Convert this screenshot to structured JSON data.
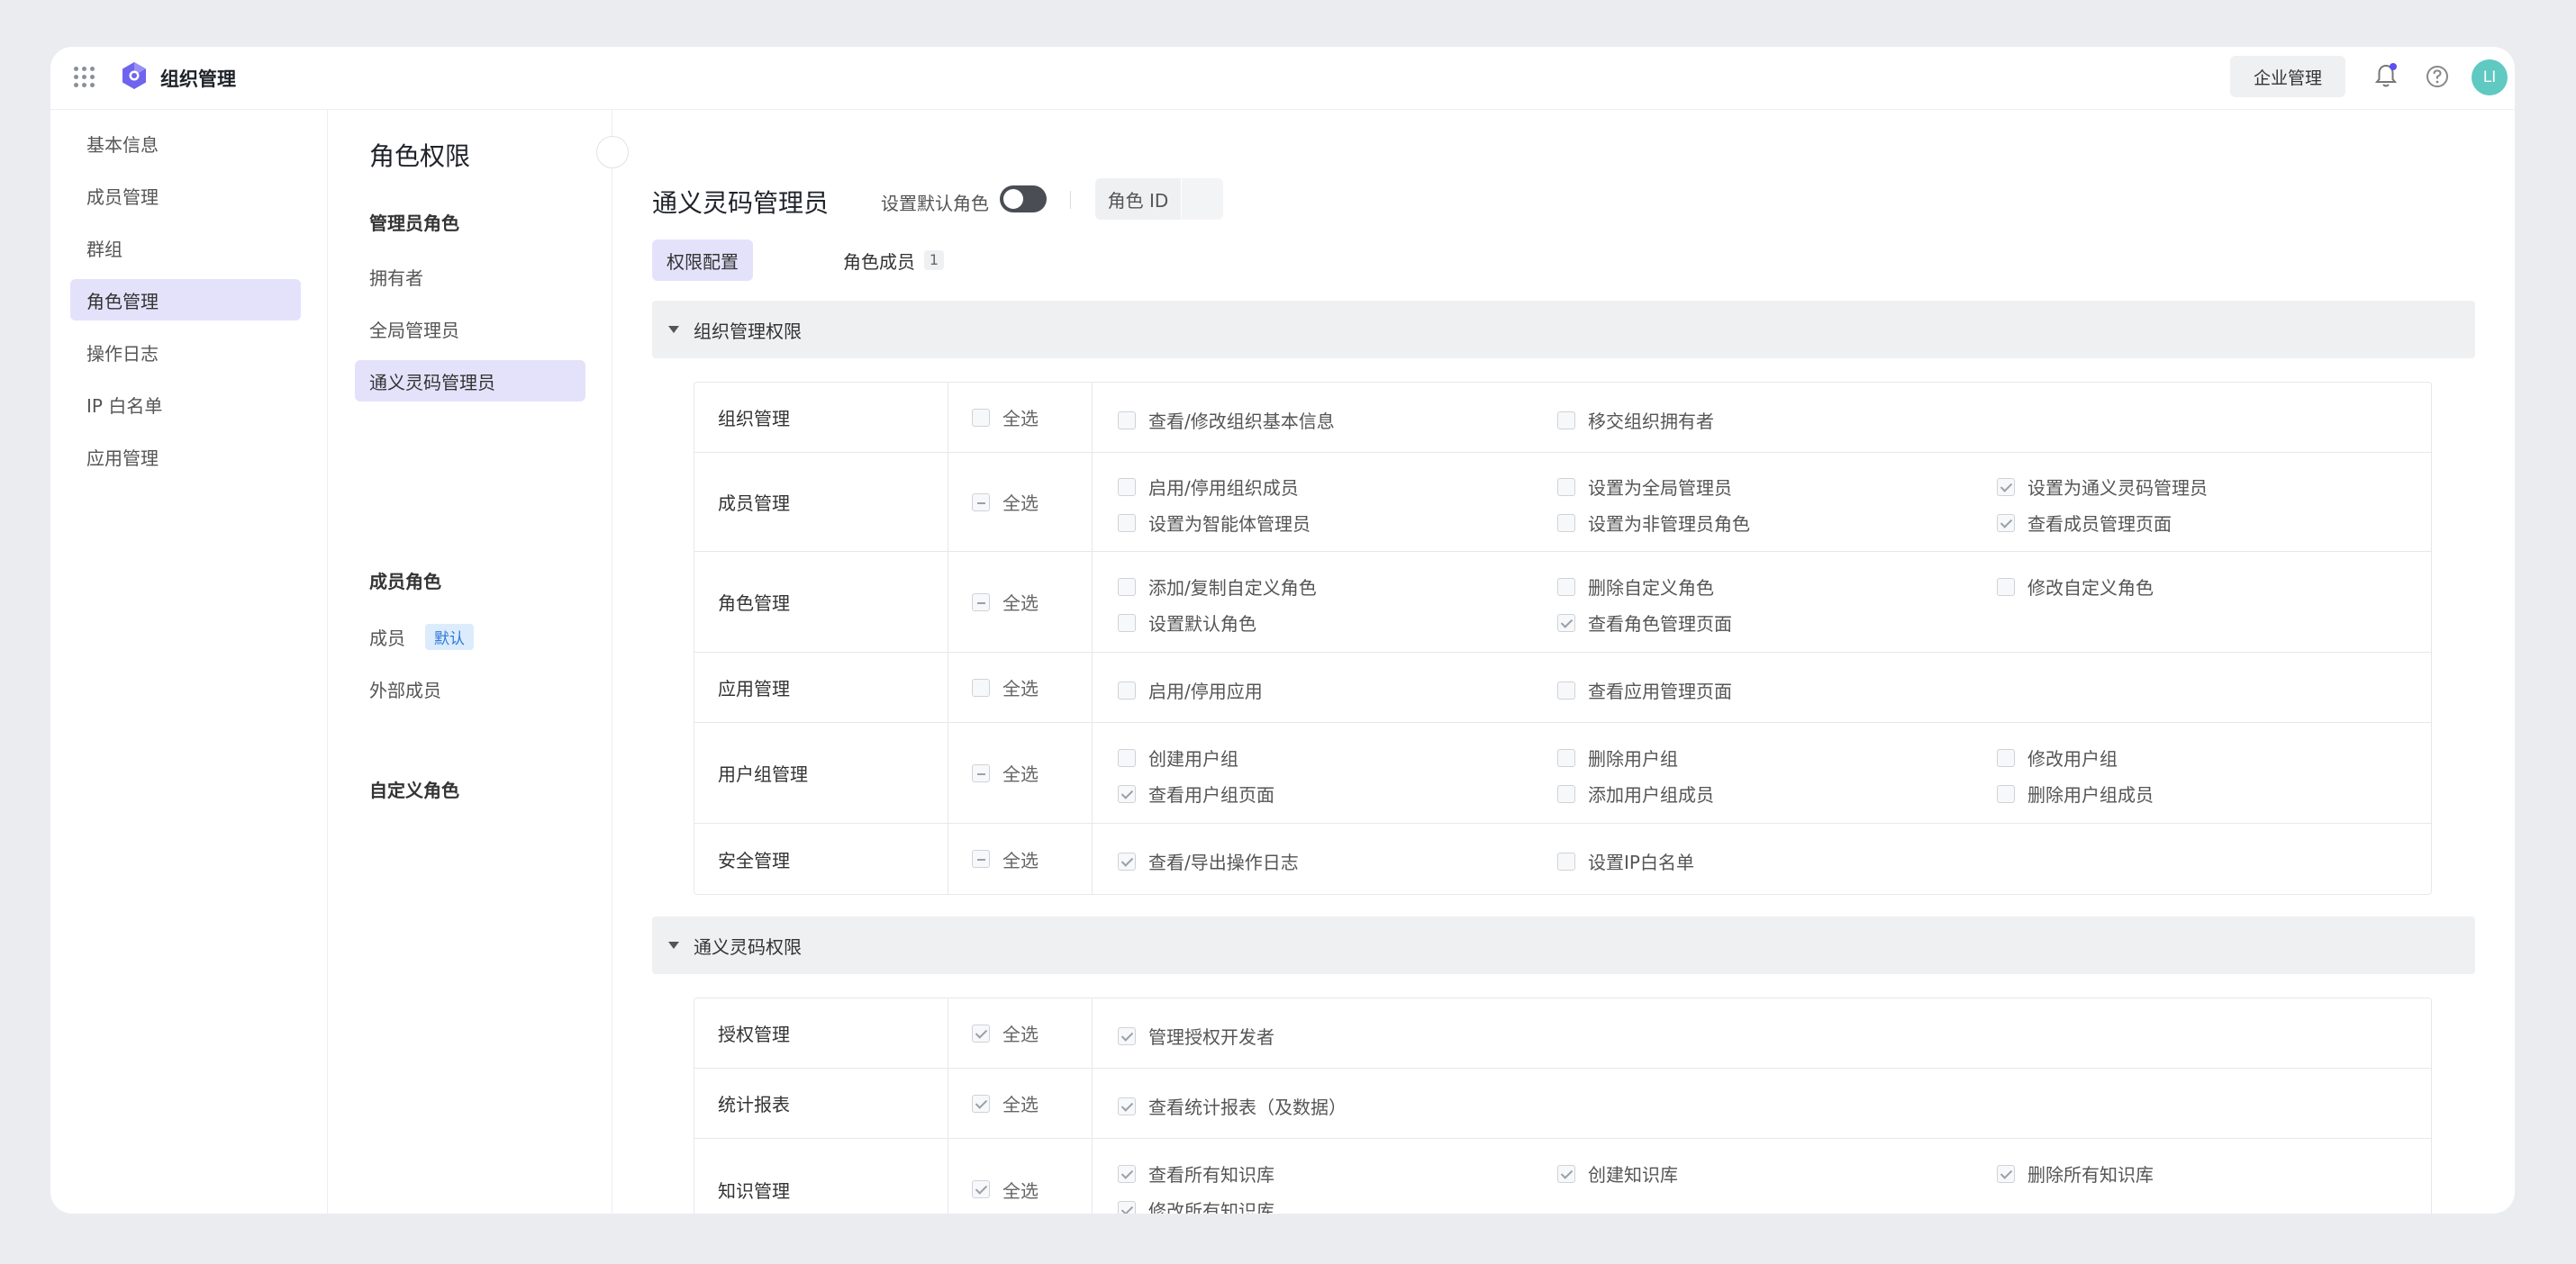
{
  "app": {
    "title": "组织管理"
  },
  "topbar": {
    "enterprise_label": "企业管理",
    "avatar_text": "LI"
  },
  "leftnav": {
    "items": [
      "基本信息",
      "成员管理",
      "群组",
      "角色管理",
      "操作日志",
      "IP 白名单",
      "应用管理"
    ],
    "active_index": 3
  },
  "rolepanel": {
    "title": "角色权限",
    "admin_section": "管理员角色",
    "admin_roles": [
      "拥有者",
      "全局管理员",
      "通义灵码管理员"
    ],
    "member_section": "成员角色",
    "member_roles": [
      "成员",
      "外部成员"
    ],
    "default_badge": "默认",
    "custom_section": "自定义角色"
  },
  "main": {
    "role_name": "通义灵码管理员",
    "set_default_label": "设置默认角色",
    "role_id_label": "角色 ID",
    "tabs": [
      {
        "label": "权限配置"
      },
      {
        "label": "角色成员",
        "count": "1"
      }
    ],
    "select_all_label": "全选",
    "groups": [
      {
        "title": "组织管理权限",
        "rows": [
          {
            "category": "组织管理",
            "state": "none",
            "options": [
              {
                "label": "查看/修改组织基本信息",
                "checked": false
              },
              {
                "label": "移交组织拥有者",
                "checked": false
              }
            ]
          },
          {
            "category": "成员管理",
            "state": "partial",
            "options": [
              {
                "label": "启用/停用组织成员",
                "checked": false
              },
              {
                "label": "设置为全局管理员",
                "checked": false
              },
              {
                "label": "设置为通义灵码管理员",
                "checked": true
              },
              {
                "label": "设置为智能体管理员",
                "checked": false
              },
              {
                "label": "设置为非管理员角色",
                "checked": false
              },
              {
                "label": "查看成员管理页面",
                "checked": true
              }
            ]
          },
          {
            "category": "角色管理",
            "state": "partial",
            "options": [
              {
                "label": "添加/复制自定义角色",
                "checked": false
              },
              {
                "label": "删除自定义角色",
                "checked": false
              },
              {
                "label": "修改自定义角色",
                "checked": false
              },
              {
                "label": "设置默认角色",
                "checked": false
              },
              {
                "label": "查看角色管理页面",
                "checked": true
              }
            ]
          },
          {
            "category": "应用管理",
            "state": "none",
            "options": [
              {
                "label": "启用/停用应用",
                "checked": false
              },
              {
                "label": "查看应用管理页面",
                "checked": false
              }
            ]
          },
          {
            "category": "用户组管理",
            "state": "partial",
            "options": [
              {
                "label": "创建用户组",
                "checked": false
              },
              {
                "label": "删除用户组",
                "checked": false
              },
              {
                "label": "修改用户组",
                "checked": false
              },
              {
                "label": "查看用户组页面",
                "checked": true
              },
              {
                "label": "添加用户组成员",
                "checked": false
              },
              {
                "label": "删除用户组成员",
                "checked": false
              }
            ]
          },
          {
            "category": "安全管理",
            "state": "partial",
            "options": [
              {
                "label": "查看/导出操作日志",
                "checked": true
              },
              {
                "label": "设置IP白名单",
                "checked": false
              }
            ]
          }
        ]
      },
      {
        "title": "通义灵码权限",
        "rows": [
          {
            "category": "授权管理",
            "state": "checked",
            "options": [
              {
                "label": "管理授权开发者",
                "checked": true
              }
            ]
          },
          {
            "category": "统计报表",
            "state": "checked",
            "options": [
              {
                "label": "查看统计报表（及数据）",
                "checked": true
              }
            ]
          },
          {
            "category": "知识管理",
            "state": "checked",
            "options": [
              {
                "label": "查看所有知识库",
                "checked": true
              },
              {
                "label": "创建知识库",
                "checked": true
              },
              {
                "label": "删除所有知识库",
                "checked": true
              },
              {
                "label": "修改所有知识库",
                "checked": true
              }
            ]
          }
        ]
      }
    ]
  },
  "colors": {
    "accent_bg": "#e4e2fb",
    "badge_bg": "#dcecfc",
    "badge_text": "#2f7ad8",
    "avatar": "#5fc9c2",
    "notify_dot": "#5b4ff0"
  }
}
